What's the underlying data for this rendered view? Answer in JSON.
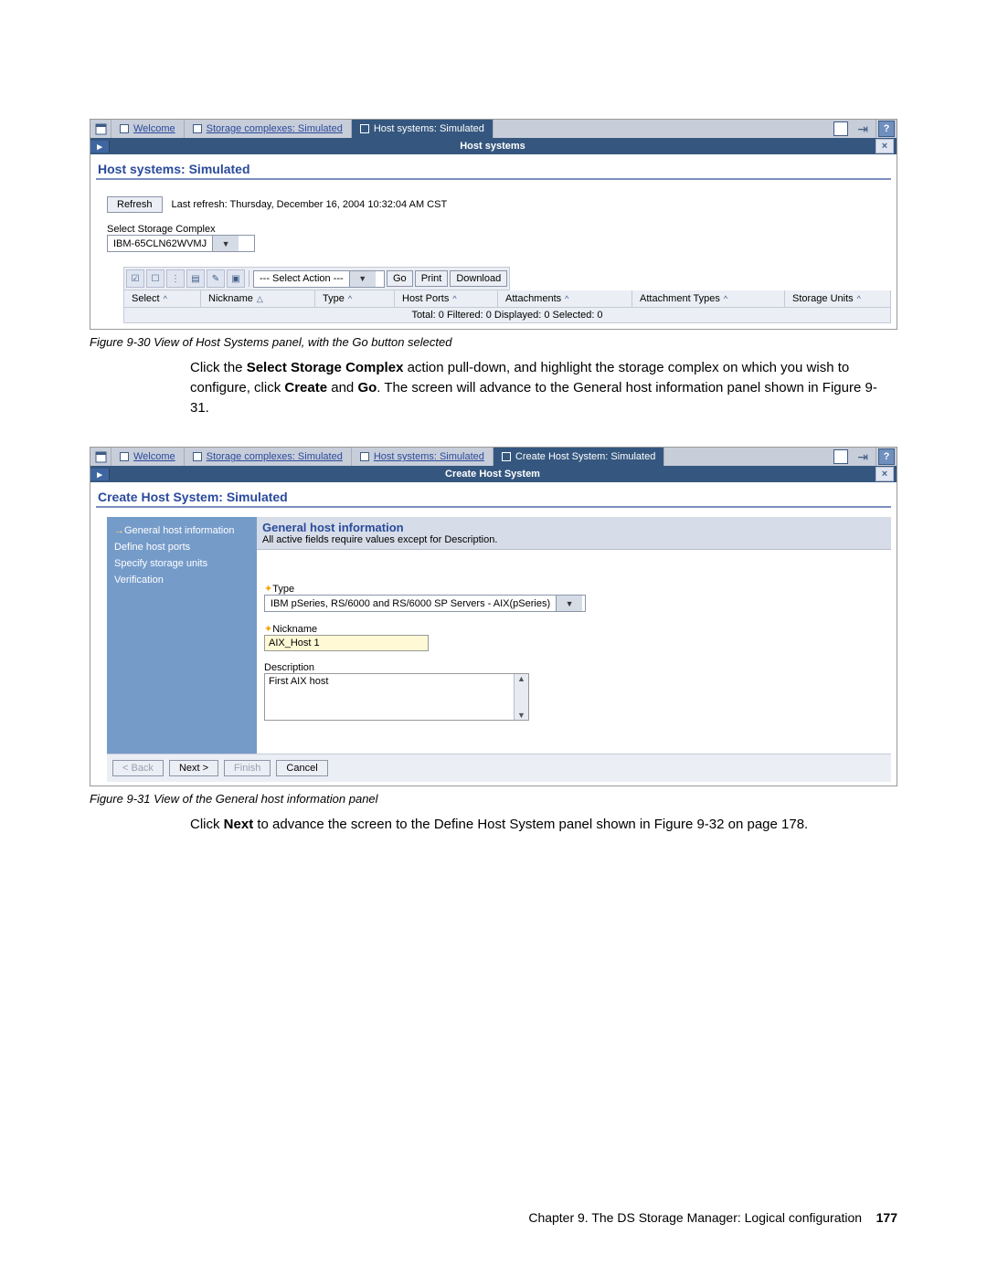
{
  "fig1": {
    "tabs": {
      "welcome": "Welcome",
      "complexes": "Storage complexes: Simulated",
      "hosts": "Host systems: Simulated"
    },
    "subbar_title": "Host systems",
    "panel_title": "Host systems: Simulated",
    "refresh_btn": "Refresh",
    "refresh_text": "Last refresh: Thursday, December 16, 2004 10:32:04 AM CST",
    "select_label": "Select Storage Complex",
    "select_value": "IBM-65CLN62WVMJ",
    "action_dropdown": "--- Select Action ---",
    "btn_go": "Go",
    "btn_print": "Print",
    "btn_download": "Download",
    "cols": {
      "select": "Select",
      "nickname": "Nickname",
      "type": "Type",
      "hostports": "Host Ports",
      "attachments": "Attachments",
      "attachment_types": "Attachment Types",
      "storage_units": "Storage Units"
    },
    "status": "Total: 0   Filtered: 0   Displayed: 0   Selected: 0"
  },
  "caption1": "Figure 9-30   View of Host Systems panel, with the Go button selected",
  "para1_a": "Click the ",
  "para1_b": "Select Storage Complex",
  "para1_c": " action pull-down, and highlight the storage complex on which you wish to configure, click ",
  "para1_d": "Create",
  "para1_e": " and ",
  "para1_f": "Go",
  "para1_g": ". The screen will advance to the General host information panel shown in Figure 9-31.",
  "fig2": {
    "tabs": {
      "welcome": "Welcome",
      "complexes": "Storage complexes: Simulated",
      "hosts": "Host systems: Simulated",
      "create": "Create Host System: Simulated"
    },
    "subbar_title": "Create Host System",
    "panel_title": "Create Host System: Simulated",
    "steps": {
      "s1": "General host information",
      "s2": "Define host ports",
      "s3": "Specify storage units",
      "s4": "Verification"
    },
    "section_title": "General host information",
    "section_sub": "All active fields require values except for Description.",
    "type_label": "Type",
    "type_value": "IBM pSeries, RS/6000 and RS/6000 SP Servers - AIX(pSeries)",
    "nick_label": "Nickname",
    "nick_value": "AIX_Host 1",
    "desc_label": "Description",
    "desc_value": "First AIX host",
    "btn_back": "< Back",
    "btn_next": "Next >",
    "btn_finish": "Finish",
    "btn_cancel": "Cancel"
  },
  "caption2": "Figure 9-31   View of the General host information panel",
  "para2_a": "Click ",
  "para2_b": "Next",
  "para2_c": " to advance the screen to the Define Host System panel shown in Figure 9-32 on page 178.",
  "footer_text": "Chapter 9. The DS Storage Manager: Logical configuration",
  "page_number": "177"
}
